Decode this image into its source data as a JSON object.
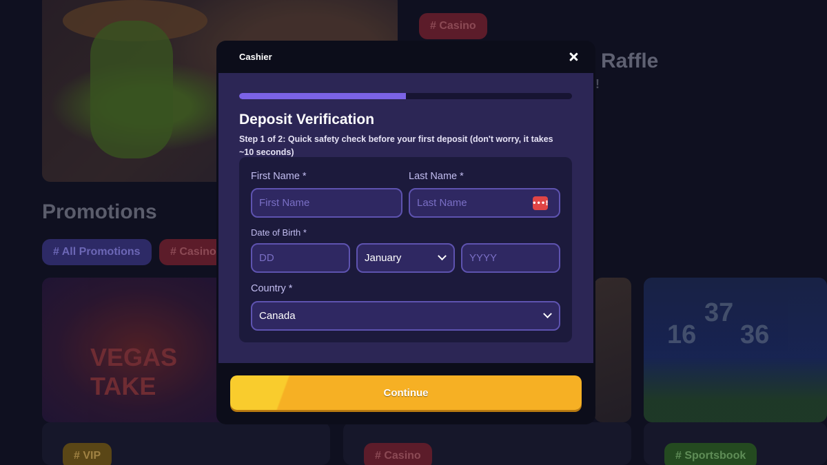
{
  "background": {
    "hero_tag": "# Casino",
    "raffle_title": "Raffle",
    "raffle_sub": "ek!",
    "promotions_title": "Promotions",
    "filter_all": "# All Promotions",
    "filter_casino": "# Casino",
    "card_tags": [
      "# VIP",
      "# Casino",
      "# Sportsbook"
    ],
    "vegas_text": "VEGAS TAKE",
    "soccer_numbers": [
      "37",
      "36",
      "16"
    ]
  },
  "modal": {
    "title": "Cashier",
    "progress_fraction": 0.5,
    "heading": "Deposit Verification",
    "subtext": "Step 1 of 2: Quick safety check before your first deposit (don't worry, it takes ~10 seconds)",
    "first_name": {
      "label": "First Name *",
      "placeholder": "First Name",
      "value": ""
    },
    "last_name": {
      "label": "Last Name *",
      "placeholder": "Last Name",
      "value": "",
      "icon_text": "•••!"
    },
    "dob": {
      "label": "Date of Birth *",
      "day_placeholder": "DD",
      "month_value": "January",
      "year_placeholder": "YYYY"
    },
    "country": {
      "label": "Country *",
      "value": "Canada"
    },
    "continue_label": "Continue"
  },
  "colors": {
    "accent_purple": "#7b63e6",
    "button_yellow": "#f6b024",
    "modal_body": "#2c2655"
  }
}
